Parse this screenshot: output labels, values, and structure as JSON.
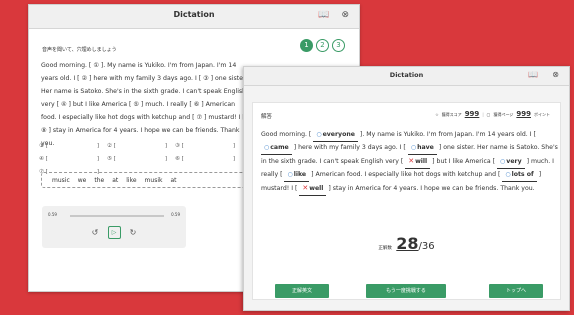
{
  "back_window": {
    "title": "Dictation",
    "instruction": "音声を聞いて、穴埋めしましょう",
    "steps": [
      "1",
      "2",
      "3"
    ],
    "passage": "Good morning. [ ① ]. My name is Yukiko. I'm from Japan. I'm 14 years old. I [ ② ] here with my family 3 days ago. I [ ③ ] one sister. Her name is Satoko. She's in the sixth grade. I can't speak English very [ ④ ] but I like America [ ⑤ ] much. I really [ ⑥ ] American food. I especially like hot dogs with ketchup and [ ⑦ ] mustard! I [ ⑧ ] stay in America for 4 years. I hope we can be friends. Thank you.",
    "blanks": [
      "①",
      "②",
      "③",
      "④",
      "⑤",
      "⑥",
      "⑦"
    ],
    "word_bank": [
      "music",
      "we",
      "the",
      "at",
      "like",
      "musik",
      "at"
    ],
    "player": {
      "current_time": "0.59",
      "total_time": "0.59",
      "progress": 0
    }
  },
  "front_window": {
    "title": "Dictation",
    "answer_label": "解答",
    "points": {
      "score_label": "獲得スコア",
      "score_value": "999",
      "page_label": "獲得ページ",
      "page_value": "999",
      "page_unit": "ポイント"
    },
    "answer": {
      "s1": "Good morning. [",
      "a1": "everyone",
      "s2": "]. My name is Yukiko. I'm from Japan. I'm 14 years old. I [",
      "a2": "came",
      "s3": "] here with my family 3 days ago. I [",
      "a3": "have",
      "s4": "] one sister. Her name is Satoko. She's in the sixth grade. I can't speak English very [",
      "a4": "will",
      "s5": "] but I like America [",
      "a5": "very",
      "s6": "] much. I really [",
      "a6": "like",
      "s7": "] American food. I especially like hot dogs with ketchup and [",
      "a7": "lots of",
      "s8": "] mustard! I [",
      "a8": "well",
      "s9": "] stay in America for 4 years. I hope we can be friends. Thank you."
    },
    "score": {
      "label": "正解数",
      "correct": "28",
      "total": "/36"
    },
    "buttons": {
      "correct_text": "正解英文",
      "retry": "もう一度挑戦する",
      "top": "トップへ"
    },
    "colors": {
      "accent": "#3a9b66",
      "correct_mark": "#3a7fc9",
      "wrong_mark": "#d9383c",
      "background": "#d9383c"
    }
  }
}
